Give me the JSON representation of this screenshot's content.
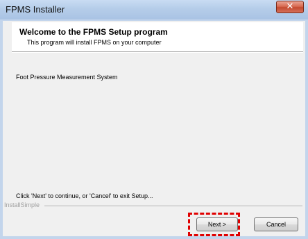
{
  "window": {
    "title": "FPMS Installer",
    "close_glyph": "✕"
  },
  "header": {
    "title": "Welcome to the FPMS  Setup program",
    "subtitle": "This program will install FPMS on your computer"
  },
  "body": {
    "description": "Foot Pressure Measurement System",
    "hint": "Click 'Next' to continue, or 'Cancel' to exit Setup..."
  },
  "footer": {
    "brand": "InstallSimple"
  },
  "buttons": {
    "next_label": "Next >",
    "cancel_label": "Cancel"
  },
  "annotation": {
    "highlight_color": "#e00000"
  },
  "colors": {
    "titlebar": "#b5cde9",
    "client": "#f0f0f0",
    "close": "#c44a30"
  }
}
